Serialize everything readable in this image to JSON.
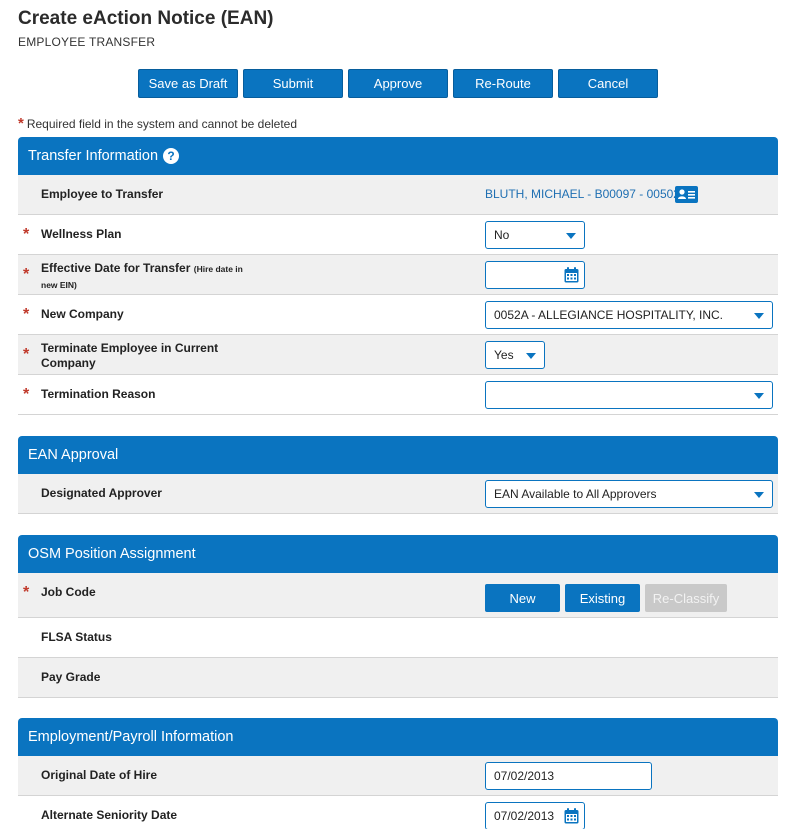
{
  "page": {
    "title": "Create eAction Notice (EAN)",
    "subtitle": "EMPLOYEE TRANSFER"
  },
  "toolbar": {
    "buttons": [
      "Save as Draft",
      "Submit",
      "Approve",
      "Re-Route",
      "Cancel"
    ]
  },
  "required_note": {
    "star": "*",
    "text": "Required field in the system and cannot be deleted"
  },
  "transfer_info": {
    "header": "Transfer Information",
    "help_icon": "?",
    "employee_label": "Employee to Transfer",
    "employee_value": "BLUTH, MICHAEL - B00097 - 00502",
    "wellness_label": "Wellness Plan",
    "wellness_value": "No",
    "effective_label": "Effective Date for Transfer",
    "effective_note": "(Hire date in new EIN)",
    "effective_value": "",
    "company_label": "New Company",
    "company_value": "0052A - ALLEGIANCE HOSPITALITY, INC.",
    "terminate_label": "Terminate Employee in Current Company",
    "terminate_value": "Yes",
    "term_reason_label": "Termination Reason",
    "term_reason_value": ""
  },
  "ean_approval": {
    "header": "EAN Approval",
    "approver_label": "Designated Approver",
    "approver_value": "EAN Available to All Approvers"
  },
  "osm": {
    "header": "OSM Position Assignment",
    "job_code_label": "Job Code",
    "btn_new": "New",
    "btn_existing": "Existing",
    "btn_reclassify": "Re-Classify",
    "flsa_label": "FLSA Status",
    "pay_grade_label": "Pay Grade"
  },
  "employment": {
    "header": "Employment/Payroll Information",
    "hire_label": "Original Date of Hire",
    "hire_value": "07/02/2013",
    "seniority_label": "Alternate Seniority Date",
    "seniority_value": "07/02/2013"
  },
  "colors": {
    "accent": "#0a74c0",
    "required_star": "#c0392b",
    "link": "#1f6fb2",
    "row_grey": "#f0f0f0",
    "disabled": "#c9c9c9"
  },
  "icons": {
    "help": "help-circle-icon",
    "employee_card": "id-card-icon",
    "calendar": "calendar-icon",
    "dropdown": "caret-down-icon"
  }
}
